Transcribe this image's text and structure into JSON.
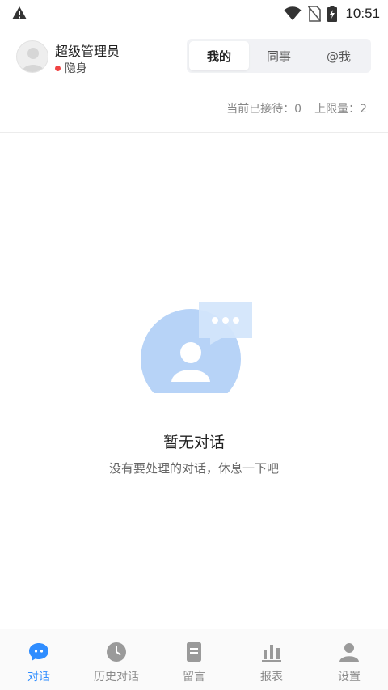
{
  "status_bar": {
    "time": "10:51"
  },
  "header": {
    "user_name": "超级管理员",
    "presence": "隐身",
    "tabs": [
      {
        "label": "我的",
        "active": true
      },
      {
        "label": "同事",
        "active": false
      },
      {
        "label": "@我",
        "active": false
      }
    ],
    "stats": {
      "current": "当前已接待：0",
      "limit": "上限量：2"
    }
  },
  "empty_state": {
    "title": "暂无对话",
    "subtitle": "没有要处理的对话，休息一下吧"
  },
  "tabbar": [
    {
      "label": "对话",
      "icon": "chat-bubble-icon",
      "active": true
    },
    {
      "label": "历史对话",
      "icon": "clock-icon",
      "active": false
    },
    {
      "label": "留言",
      "icon": "note-icon",
      "active": false
    },
    {
      "label": "报表",
      "icon": "bar-chart-icon",
      "active": false
    },
    {
      "label": "设置",
      "icon": "user-settings-icon",
      "active": false
    }
  ],
  "colors": {
    "accent": "#2f8dff",
    "inactive": "#8a8a8a",
    "presence_dot": "#f04444"
  }
}
